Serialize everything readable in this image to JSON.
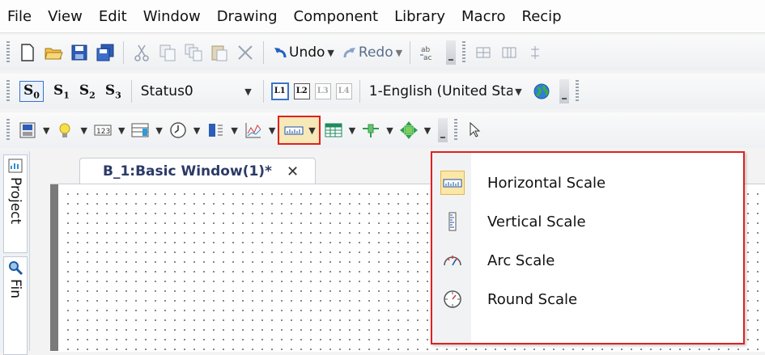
{
  "menu": {
    "items": [
      "File",
      "View",
      "Edit",
      "Window",
      "Drawing",
      "Component",
      "Library",
      "Macro",
      "Recip"
    ]
  },
  "toolbar1": {
    "undo_label": "Undo",
    "redo_label": "Redo"
  },
  "toolbar2": {
    "status_buttons": [
      "S0",
      "S1",
      "S2",
      "S3"
    ],
    "status_value": "Status0",
    "layer_buttons": [
      "L1",
      "L2",
      "L3",
      "L4"
    ],
    "language_value": "1-English (United Sta"
  },
  "doc": {
    "tab_title": "B_1:Basic Window(1)*",
    "close_glyph": "✕"
  },
  "leftpanel": {
    "project_label": "Project",
    "find_label": "Fin"
  },
  "scale_menu": {
    "items": [
      {
        "label": "Horizontal Scale",
        "icon": "horizontal-scale-icon"
      },
      {
        "label": "Vertical Scale",
        "icon": "vertical-scale-icon"
      },
      {
        "label": "Arc Scale",
        "icon": "arc-scale-icon"
      },
      {
        "label": "Round Scale",
        "icon": "round-scale-icon"
      }
    ]
  },
  "colors": {
    "highlight_border": "#e02020",
    "selected_fill": "#f7e9b7",
    "accent_blue": "#3a73c7"
  }
}
